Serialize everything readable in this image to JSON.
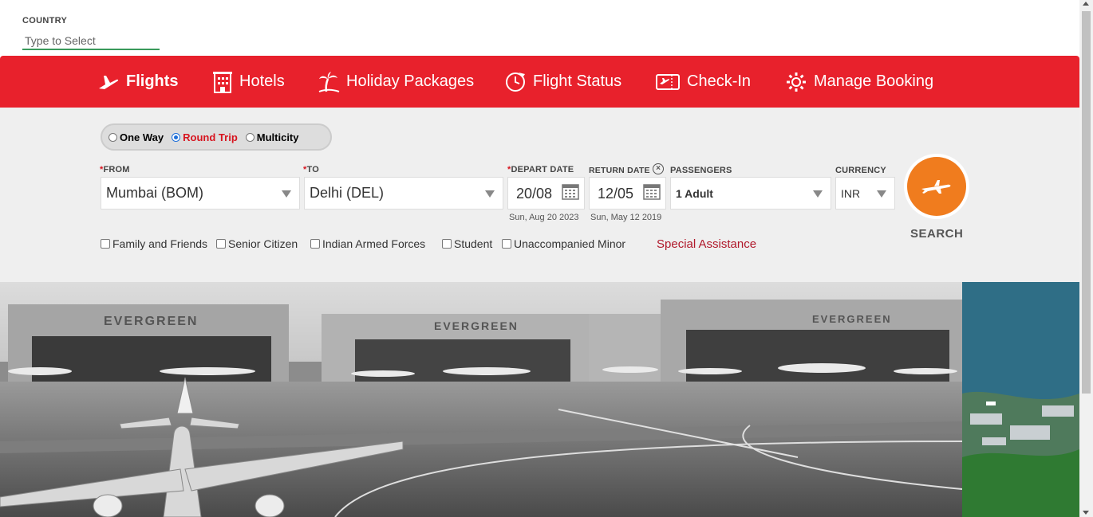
{
  "country": {
    "label": "COUNTRY",
    "placeholder": "Type to Select"
  },
  "nav": {
    "items": [
      {
        "label": "Flights",
        "icon": "plane-icon",
        "active": true
      },
      {
        "label": "Hotels",
        "icon": "hotel-icon"
      },
      {
        "label": "Holiday Packages",
        "icon": "palm-tree-icon"
      },
      {
        "label": "Flight Status",
        "icon": "clock-plane-icon"
      },
      {
        "label": "Check-In",
        "icon": "ticket-icon"
      },
      {
        "label": "Manage Booking",
        "icon": "gear-icon"
      }
    ]
  },
  "trip_type": {
    "options": [
      "One Way",
      "Round Trip",
      "Multicity"
    ],
    "selected": "Round Trip"
  },
  "form": {
    "from": {
      "label": "FROM",
      "value": "Mumbai (BOM)"
    },
    "to": {
      "label": "TO",
      "value": "Delhi (DEL)"
    },
    "depart": {
      "label": "DEPART DATE",
      "value": "20/08",
      "sub": "Sun, Aug 20 2023"
    },
    "return": {
      "label": "RETURN DATE",
      "value": "12/05",
      "sub": "Sun, May 12 2019"
    },
    "passengers": {
      "label": "PASSENGERS",
      "value": "1 Adult"
    },
    "currency": {
      "label": "CURRENCY",
      "value": "INR"
    },
    "required_mark": "*"
  },
  "search": {
    "label": "SEARCH"
  },
  "fare_options": [
    "Family and Friends",
    "Senior Citizen",
    "Indian Armed Forces",
    "Student",
    "Unaccompanied Minor"
  ],
  "special_assistance": "Special Assistance",
  "hero": {
    "hangar_text": "EVERGREEN"
  },
  "colors": {
    "brand_red": "#e8212c",
    "search_orange": "#f07c1e",
    "panel_bg": "#efefef",
    "selected_red": "#d7141f"
  }
}
